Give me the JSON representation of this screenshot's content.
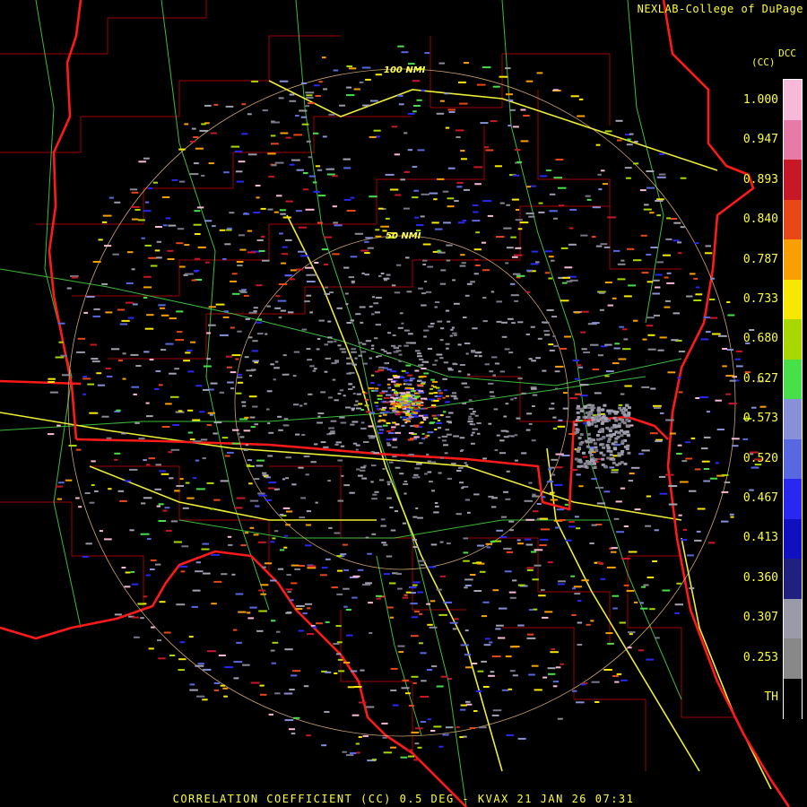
{
  "credit": "NEXLAB-College of DuPage",
  "product_code": "DCC",
  "units": "(CC)",
  "footer": "CORRELATION COEFFICIENT (CC) 0.5 DEG - KVAX 21 JAN 26 07:31",
  "range_rings": [
    {
      "label": "50 NMI"
    },
    {
      "label": "100 NMI"
    }
  ],
  "legend": {
    "ticks": [
      "1.000",
      "0.947",
      "0.893",
      "0.840",
      "0.787",
      "0.733",
      "0.680",
      "0.627",
      "0.573",
      "0.520",
      "0.467",
      "0.413",
      "0.360",
      "0.307",
      "0.253",
      "TH"
    ],
    "colors": [
      "#f8b8d8",
      "#e87aa8",
      "#c81828",
      "#e84818",
      "#f8a000",
      "#f8e800",
      "#a8d800",
      "#48e048",
      "#8890d8",
      "#5868e0",
      "#2828f0",
      "#1010c0",
      "#202080",
      "#9a9aa8",
      "#888888",
      "#000000"
    ]
  },
  "colors": {
    "state_border": "#ff0000",
    "county_line": "#aa0000",
    "highway": "#ffff44",
    "road": "#55ff55",
    "range_ring": "#ffcc88",
    "text": "#ffff33"
  }
}
